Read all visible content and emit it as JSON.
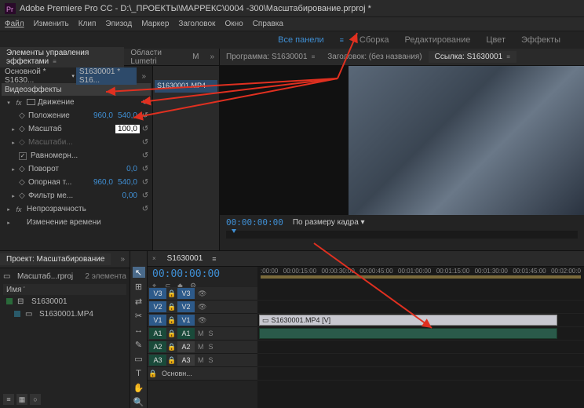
{
  "titlebar": "Adobe Premiere Pro CC - D:\\_ПРОЕКТЫ\\МАРРЕКС\\0004 -300\\Масштабирование.prproj *",
  "menu": [
    "Файл",
    "Изменить",
    "Клип",
    "Эпизод",
    "Маркер",
    "Заголовок",
    "Окно",
    "Справка"
  ],
  "workspaces": [
    "Все панели",
    "Сборка",
    "Редактирование",
    "Цвет",
    "Эффекты"
  ],
  "ecp": {
    "tab": "Элементы управления эффектами",
    "lumetri": "Области Lumetri",
    "lumetri_m": "M",
    "source_master": "Основной * S1630...",
    "source_clip": "S1630001 * S16...",
    "clip_chip": "S1630001.MP4",
    "section_video": "Видеоэффекты",
    "motion": "Движение",
    "position": "Положение",
    "pos_x": "960,0",
    "pos_y": "540,0",
    "scale": "Масштаб",
    "scale_v": "100,0",
    "scale_w": "Масштаби...",
    "uniform": "Равномерн...",
    "rotation": "Поворот",
    "rot_v": "0,0",
    "anchor": "Опорная т...",
    "anc_x": "960,0",
    "anc_y": "540,0",
    "antiflicker": "Фильтр ме...",
    "af_v": "0,00",
    "opacity": "Непрозрачность",
    "timeremap": "Изменение времени"
  },
  "program": {
    "tab1": "Программа: S1630001",
    "tab2": "Заголовок: (без названия)",
    "tab3": "Ссылка: S1630001",
    "tc": "00:00:00:00",
    "fit": "По размеру кадра"
  },
  "project": {
    "tab": "Проект: Масштабирование",
    "bin": "Масштаб...rproj",
    "count": "2 элемента",
    "col_name": "Имя",
    "items": [
      "S1630001",
      "S1630001.MP4"
    ]
  },
  "timeline": {
    "seq": "S1630001",
    "tc": "00:00:00:00",
    "ticks": [
      ":00:00",
      "00:00:15:00",
      "00:00:30:00",
      "00:00:45:00",
      "00:01:00:00",
      "00:01:15:00",
      "00:01:30:00",
      "00:01:45:00",
      "00:02:00:0"
    ],
    "v3": "V3",
    "v2": "V2",
    "v1": "V1",
    "a1": "A1",
    "a2": "A2",
    "a3": "A3",
    "clip_v": "S1630001.MP4 [V]",
    "master": "Основн..."
  },
  "tools": [
    "▲",
    "⊞",
    "⇄",
    "✂",
    "↔",
    "✎",
    "▭",
    "T",
    "✋",
    "🔍"
  ]
}
